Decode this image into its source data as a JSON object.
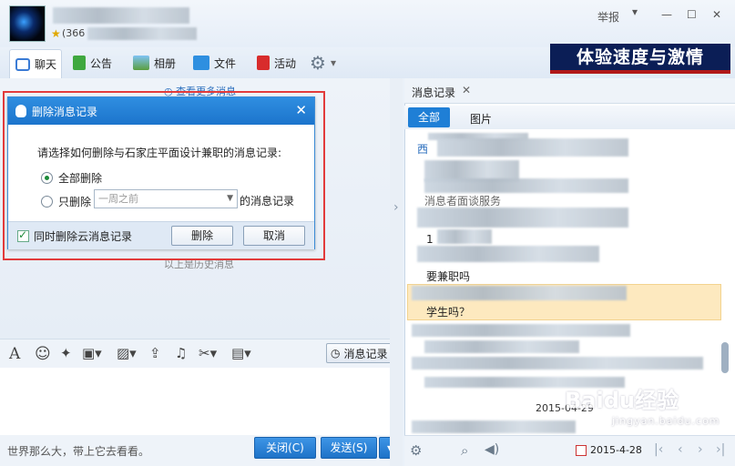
{
  "header": {
    "report_label": "举报",
    "minimize": "—",
    "maximize": "☐",
    "close": "✕",
    "id_text": "(366",
    "star": "★"
  },
  "toolbar": {
    "chat": "聊天",
    "notice": "公告",
    "album": "相册",
    "files": "文件",
    "activity": "活动",
    "settings_caret": "▾"
  },
  "banner": {
    "text": "体验速度与激情"
  },
  "chat": {
    "more_messages": "查看更多消息",
    "history_note": "以上是历史消息"
  },
  "dialog": {
    "title": "删除消息记录",
    "close": "✕",
    "prompt": "请选择如何删除与石家庄平面设计兼职的消息记录:",
    "option_all": "全部删除",
    "option_only": "只删除",
    "period_value": "一周之前",
    "period_suffix": "的消息记录",
    "cloud_checkbox": "同时删除云消息记录",
    "delete_button": "删除",
    "cancel_button": "取消"
  },
  "input_toolbar": {
    "font": "A",
    "emoji": "☺",
    "msg_record": "消息记录",
    "msg_record_caret": "▾"
  },
  "bottom": {
    "hint": "世界那么大，带上它去看看。",
    "close_button": "关闭(C)",
    "send_button": "发送(S)",
    "send_menu": "▾"
  },
  "right_panel": {
    "tab_label": "消息记录",
    "tab_close": "✕",
    "sub_all": "全部",
    "sub_pics": "图片",
    "visible_text": [
      "西",
      "消息者面谈服务",
      "1",
      "要兼职吗",
      "学生吗？"
    ],
    "date_separator": "2015-04-29",
    "footer_date": "2015-4-28",
    "nav": [
      "|‹",
      "‹",
      "›",
      "›|"
    ]
  },
  "watermark": {
    "main": "Baidu经验",
    "sub": "jingyan.baidu.com"
  }
}
